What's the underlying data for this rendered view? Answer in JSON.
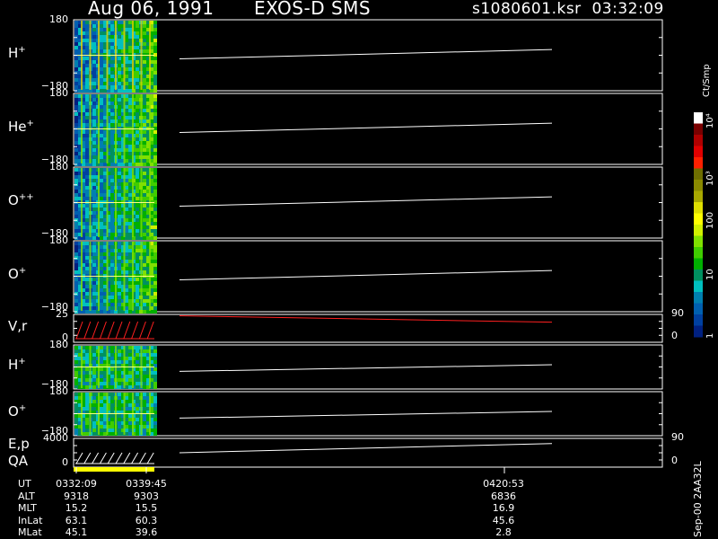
{
  "header": {
    "date": "Aug 06, 1991",
    "instrument": "EXOS-D SMS",
    "file": "s1080601.ksr",
    "time": "03:32:09"
  },
  "colors": {
    "trace": "#ffffff",
    "velocity_trace": "#ff2020",
    "qa_bar": "#ffff00",
    "background": "#000000"
  },
  "chart_data": {
    "type": "heatmap",
    "panels": [
      {
        "label": "H",
        "sup": "+",
        "ylim": [
          -180,
          180
        ],
        "yticks": [
          "180",
          "−180"
        ],
        "trace": [
          0.45,
          0.58
        ]
      },
      {
        "label": "He",
        "sup": "+",
        "ylim": [
          -180,
          180
        ],
        "yticks": [
          "180",
          "−180"
        ],
        "trace": [
          0.45,
          0.58
        ]
      },
      {
        "label": "O",
        "sup": "++",
        "ylim": [
          -180,
          180
        ],
        "yticks": [
          "180",
          "−180"
        ],
        "trace": [
          0.45,
          0.58
        ]
      },
      {
        "label": "O",
        "sup": "+",
        "ylim": [
          -180,
          180
        ],
        "yticks": [
          "180",
          "−180"
        ],
        "trace": [
          0.45,
          0.58
        ]
      },
      {
        "label": "V,r",
        "sup": "",
        "ylim": [
          0,
          25
        ],
        "yticks": [
          "25",
          "0"
        ],
        "rticks": [
          "90",
          "0"
        ],
        "trace": [
          0.95,
          0.72
        ]
      },
      {
        "label": "H",
        "sup": "+",
        "ylim": [
          -180,
          180
        ],
        "yticks": [
          "180",
          "−180"
        ],
        "trace": [
          0.4,
          0.55
        ]
      },
      {
        "label": "O",
        "sup": "+",
        "ylim": [
          -180,
          180
        ],
        "yticks": [
          "180",
          "−180"
        ],
        "trace": [
          0.4,
          0.55
        ]
      },
      {
        "label": "E,p",
        "sup": "",
        "label2": "QA",
        "ylim": [
          0,
          4000
        ],
        "yticks": [
          "4000",
          "0"
        ],
        "rticks": [
          "90",
          "0"
        ],
        "trace": [
          0.5,
          0.82
        ]
      }
    ],
    "colorbar": {
      "unit": "Ct/Smp",
      "ticks": [
        "10⁴",
        "10³",
        "100",
        "10",
        "1"
      ],
      "colors": [
        "#ffffff",
        "#7a0000",
        "#b00000",
        "#e00000",
        "#ff2000",
        "#6e6e00",
        "#8a8a00",
        "#a8a800",
        "#dede00",
        "#ffff00",
        "#d0f000",
        "#80e000",
        "#40cc00",
        "#00b000",
        "#009060",
        "#00c0c0",
        "#0080b0",
        "#0060b0",
        "#0040a0",
        "#002080"
      ]
    },
    "table": {
      "rows": [
        {
          "name": "UT",
          "values": [
            "0332:09",
            "0339:45",
            "0420:53"
          ]
        },
        {
          "name": "ALT",
          "values": [
            "9318",
            "9303",
            "6836"
          ]
        },
        {
          "name": "MLT",
          "values": [
            "15.2",
            "15.5",
            "16.9"
          ]
        },
        {
          "name": "InLat",
          "values": [
            "63.1",
            "60.3",
            "45.6"
          ]
        },
        {
          "name": "MLat",
          "values": [
            "45.1",
            "39.6",
            "2.8"
          ]
        }
      ]
    },
    "footer_vertical": "Sep-00  2AA32L"
  }
}
